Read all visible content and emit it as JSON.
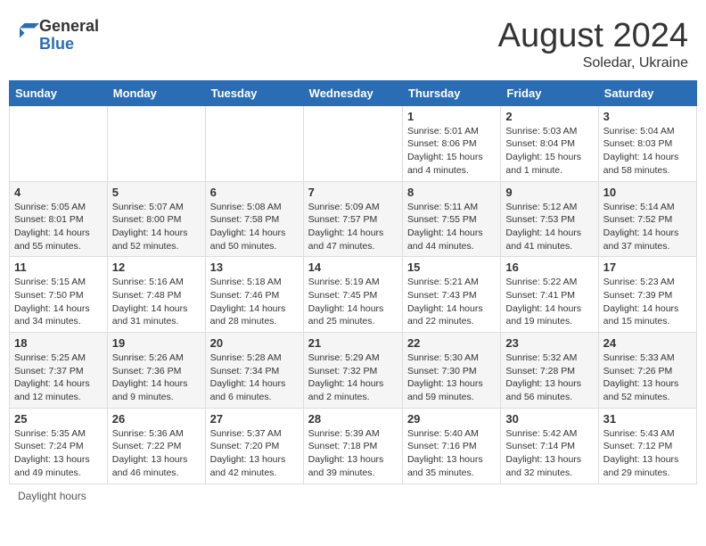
{
  "header": {
    "logo_general": "General",
    "logo_blue": "Blue",
    "month_title": "August 2024",
    "location": "Soledar, Ukraine"
  },
  "weekdays": [
    "Sunday",
    "Monday",
    "Tuesday",
    "Wednesday",
    "Thursday",
    "Friday",
    "Saturday"
  ],
  "footer_text": "Daylight hours",
  "weeks": [
    [
      {
        "day": "",
        "info": ""
      },
      {
        "day": "",
        "info": ""
      },
      {
        "day": "",
        "info": ""
      },
      {
        "day": "",
        "info": ""
      },
      {
        "day": "1",
        "info": "Sunrise: 5:01 AM\nSunset: 8:06 PM\nDaylight: 15 hours\nand 4 minutes."
      },
      {
        "day": "2",
        "info": "Sunrise: 5:03 AM\nSunset: 8:04 PM\nDaylight: 15 hours\nand 1 minute."
      },
      {
        "day": "3",
        "info": "Sunrise: 5:04 AM\nSunset: 8:03 PM\nDaylight: 14 hours\nand 58 minutes."
      }
    ],
    [
      {
        "day": "4",
        "info": "Sunrise: 5:05 AM\nSunset: 8:01 PM\nDaylight: 14 hours\nand 55 minutes."
      },
      {
        "day": "5",
        "info": "Sunrise: 5:07 AM\nSunset: 8:00 PM\nDaylight: 14 hours\nand 52 minutes."
      },
      {
        "day": "6",
        "info": "Sunrise: 5:08 AM\nSunset: 7:58 PM\nDaylight: 14 hours\nand 50 minutes."
      },
      {
        "day": "7",
        "info": "Sunrise: 5:09 AM\nSunset: 7:57 PM\nDaylight: 14 hours\nand 47 minutes."
      },
      {
        "day": "8",
        "info": "Sunrise: 5:11 AM\nSunset: 7:55 PM\nDaylight: 14 hours\nand 44 minutes."
      },
      {
        "day": "9",
        "info": "Sunrise: 5:12 AM\nSunset: 7:53 PM\nDaylight: 14 hours\nand 41 minutes."
      },
      {
        "day": "10",
        "info": "Sunrise: 5:14 AM\nSunset: 7:52 PM\nDaylight: 14 hours\nand 37 minutes."
      }
    ],
    [
      {
        "day": "11",
        "info": "Sunrise: 5:15 AM\nSunset: 7:50 PM\nDaylight: 14 hours\nand 34 minutes."
      },
      {
        "day": "12",
        "info": "Sunrise: 5:16 AM\nSunset: 7:48 PM\nDaylight: 14 hours\nand 31 minutes."
      },
      {
        "day": "13",
        "info": "Sunrise: 5:18 AM\nSunset: 7:46 PM\nDaylight: 14 hours\nand 28 minutes."
      },
      {
        "day": "14",
        "info": "Sunrise: 5:19 AM\nSunset: 7:45 PM\nDaylight: 14 hours\nand 25 minutes."
      },
      {
        "day": "15",
        "info": "Sunrise: 5:21 AM\nSunset: 7:43 PM\nDaylight: 14 hours\nand 22 minutes."
      },
      {
        "day": "16",
        "info": "Sunrise: 5:22 AM\nSunset: 7:41 PM\nDaylight: 14 hours\nand 19 minutes."
      },
      {
        "day": "17",
        "info": "Sunrise: 5:23 AM\nSunset: 7:39 PM\nDaylight: 14 hours\nand 15 minutes."
      }
    ],
    [
      {
        "day": "18",
        "info": "Sunrise: 5:25 AM\nSunset: 7:37 PM\nDaylight: 14 hours\nand 12 minutes."
      },
      {
        "day": "19",
        "info": "Sunrise: 5:26 AM\nSunset: 7:36 PM\nDaylight: 14 hours\nand 9 minutes."
      },
      {
        "day": "20",
        "info": "Sunrise: 5:28 AM\nSunset: 7:34 PM\nDaylight: 14 hours\nand 6 minutes."
      },
      {
        "day": "21",
        "info": "Sunrise: 5:29 AM\nSunset: 7:32 PM\nDaylight: 14 hours\nand 2 minutes."
      },
      {
        "day": "22",
        "info": "Sunrise: 5:30 AM\nSunset: 7:30 PM\nDaylight: 13 hours\nand 59 minutes."
      },
      {
        "day": "23",
        "info": "Sunrise: 5:32 AM\nSunset: 7:28 PM\nDaylight: 13 hours\nand 56 minutes."
      },
      {
        "day": "24",
        "info": "Sunrise: 5:33 AM\nSunset: 7:26 PM\nDaylight: 13 hours\nand 52 minutes."
      }
    ],
    [
      {
        "day": "25",
        "info": "Sunrise: 5:35 AM\nSunset: 7:24 PM\nDaylight: 13 hours\nand 49 minutes."
      },
      {
        "day": "26",
        "info": "Sunrise: 5:36 AM\nSunset: 7:22 PM\nDaylight: 13 hours\nand 46 minutes."
      },
      {
        "day": "27",
        "info": "Sunrise: 5:37 AM\nSunset: 7:20 PM\nDaylight: 13 hours\nand 42 minutes."
      },
      {
        "day": "28",
        "info": "Sunrise: 5:39 AM\nSunset: 7:18 PM\nDaylight: 13 hours\nand 39 minutes."
      },
      {
        "day": "29",
        "info": "Sunrise: 5:40 AM\nSunset: 7:16 PM\nDaylight: 13 hours\nand 35 minutes."
      },
      {
        "day": "30",
        "info": "Sunrise: 5:42 AM\nSunset: 7:14 PM\nDaylight: 13 hours\nand 32 minutes."
      },
      {
        "day": "31",
        "info": "Sunrise: 5:43 AM\nSunset: 7:12 PM\nDaylight: 13 hours\nand 29 minutes."
      }
    ]
  ]
}
